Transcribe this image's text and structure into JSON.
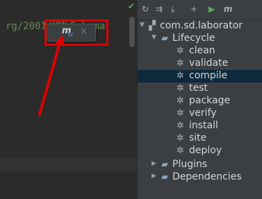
{
  "editor": {
    "code_text": "rg/2001/XMLSchema"
  },
  "popup": {
    "maven_label": "m",
    "refresh_glyph": "↻",
    "close_glyph": "×"
  },
  "toolbar": {
    "icons": [
      "refresh-icon",
      "reimport-icon",
      "download-icon",
      "add-icon",
      "run-icon",
      "maven-icon"
    ],
    "refresh": "↻",
    "reimport": "⇉",
    "download": "⤓",
    "add": "+",
    "run": "▶",
    "maven": "m"
  },
  "tree": {
    "project": "com.sd.laborator",
    "lifecycle": "Lifecycle",
    "goals": [
      "clean",
      "validate",
      "compile",
      "test",
      "package",
      "verify",
      "install",
      "site",
      "deploy"
    ],
    "selected_goal": "compile",
    "plugins": "Plugins",
    "dependencies": "Dependencies"
  },
  "colors": {
    "highlight": "#e00000",
    "selection": "#0d293e",
    "panel_bg": "#3c3f41",
    "editor_bg": "#2b2b2b"
  }
}
